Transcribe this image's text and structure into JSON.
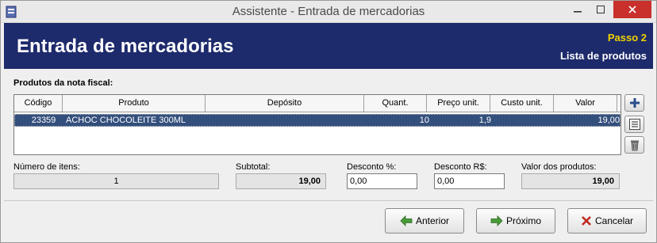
{
  "window": {
    "title": "Assistente - Entrada de mercadorias"
  },
  "header": {
    "title": "Entrada de mercadorias",
    "step": "Passo 2",
    "subtitle": "Lista de produtos"
  },
  "products": {
    "section_label": "Produtos da nota fiscal:",
    "columns": [
      "Código",
      "Produto",
      "Depósito",
      "Quant.",
      "Preço unit.",
      "Custo unit.",
      "Valor"
    ],
    "rows": [
      {
        "codigo": "23359",
        "produto": "ACHOC CHOCOLEITE 300ML",
        "deposito": "",
        "quant": "10",
        "preco": "1,9",
        "custo": "",
        "valor": "19,00"
      }
    ]
  },
  "summary": {
    "items_label": "Número de itens:",
    "items_value": "1",
    "subtotal_label": "Subtotal:",
    "subtotal_value": "19,00",
    "discount_pct_label": "Desconto %:",
    "discount_pct_value": "0,00",
    "discount_rs_label": "Desconto R$:",
    "discount_rs_value": "0,00",
    "total_label": "Valor dos produtos:",
    "total_value": "19,00"
  },
  "buttons": {
    "back": "Anterior",
    "next": "Próximo",
    "cancel": "Cancelar"
  },
  "icons": {
    "add": "plus-icon",
    "details": "list-icon",
    "delete": "trash-icon"
  },
  "colors": {
    "header_bg": "#1d2a6b",
    "step_text": "#f1d400",
    "selected_row": "#334f7c",
    "close_button": "#c9302c"
  }
}
